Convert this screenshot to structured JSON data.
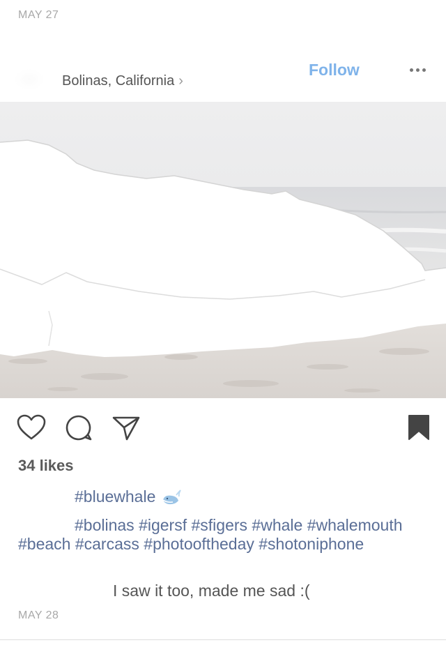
{
  "post": {
    "date_top": "MAY 27",
    "location": "Bolinas, California",
    "follow_label": "Follow",
    "likes": "34 likes",
    "caption_line1": "#bluewhale",
    "caption_rest": "#bolinas #igersf #sfigers #whale #whalemouth #beach #carcass #photooftheday #shotoniphone",
    "comment": "I saw it too, made me sad :(",
    "date_bottom": "MAY 28"
  },
  "icons": [
    "avatar",
    "chevron-right-icon",
    "more-options-icon",
    "heart-icon",
    "comment-icon",
    "share-icon",
    "bookmark-icon",
    "whale-emoji-icon"
  ],
  "colors": {
    "follow": "#7fb3ea",
    "hashtag": "#5a6e96",
    "date": "#a8a8a8",
    "icon": "#444444"
  }
}
